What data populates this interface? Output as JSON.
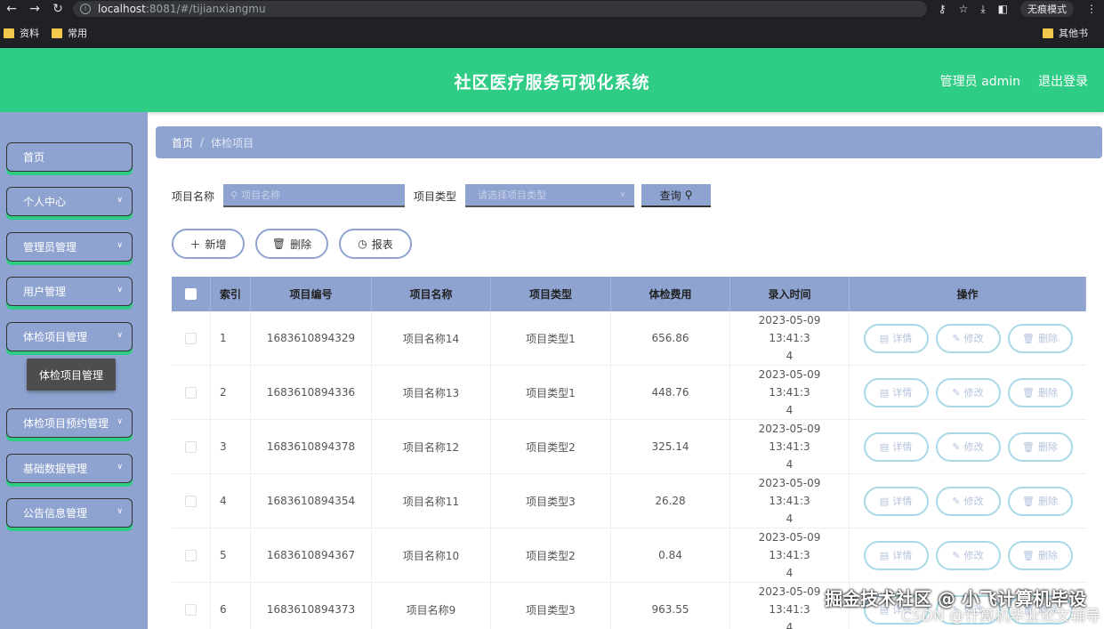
{
  "browser": {
    "url_host": "localhost",
    "url_path": ":8081/#/tijianxiangmu",
    "incognito_label": "无痕模式",
    "bookmarks": [
      "资料",
      "常用"
    ],
    "bookmarks_right": "其他书"
  },
  "header": {
    "title": "社区医疗服务可视化系统",
    "user": "管理员 admin",
    "logout": "退出登录"
  },
  "sidebar": {
    "items": [
      {
        "label": "首页"
      },
      {
        "label": "个人中心"
      },
      {
        "label": "管理员管理"
      },
      {
        "label": "用户管理"
      },
      {
        "label": "体检项目管理"
      },
      {
        "label": "体检项目预约管理"
      },
      {
        "label": "基础数据管理"
      },
      {
        "label": "公告信息管理"
      }
    ],
    "submenu_active": "体检项目管理"
  },
  "breadcrumb": {
    "home": "首页",
    "separator": "/",
    "current": "体检项目"
  },
  "search": {
    "name_label": "项目名称",
    "name_placeholder": "项目名称",
    "type_label": "项目类型",
    "type_placeholder": "请选择项目类型",
    "query_label": "查询"
  },
  "actions": {
    "add": "新增",
    "delete": "删除",
    "report": "报表"
  },
  "table": {
    "headers": [
      "索引",
      "项目编号",
      "项目名称",
      "项目类型",
      "体检费用",
      "录入时间",
      "操作"
    ],
    "op_labels": {
      "detail": "详情",
      "edit": "修改",
      "delete": "删除"
    },
    "rows": [
      {
        "idx": "1",
        "code": "1683610894329",
        "name": "项目名称14",
        "type": "项目类型1",
        "fee": "656.86",
        "time_a": "2023-05-09 13:41:3",
        "time_b": "4"
      },
      {
        "idx": "2",
        "code": "1683610894336",
        "name": "项目名称13",
        "type": "项目类型1",
        "fee": "448.76",
        "time_a": "2023-05-09 13:41:3",
        "time_b": "4"
      },
      {
        "idx": "3",
        "code": "1683610894378",
        "name": "项目名称12",
        "type": "项目类型2",
        "fee": "325.14",
        "time_a": "2023-05-09 13:41:3",
        "time_b": "4"
      },
      {
        "idx": "4",
        "code": "1683610894354",
        "name": "项目名称11",
        "type": "项目类型3",
        "fee": "26.28",
        "time_a": "2023-05-09 13:41:3",
        "time_b": "4"
      },
      {
        "idx": "5",
        "code": "1683610894367",
        "name": "项目名称10",
        "type": "项目类型2",
        "fee": "0.84",
        "time_a": "2023-05-09 13:41:3",
        "time_b": "4"
      },
      {
        "idx": "6",
        "code": "1683610894373",
        "name": "项目名称9",
        "type": "项目类型3",
        "fee": "963.55",
        "time_a": "2023-05-09 13:41:3",
        "time_b": "4"
      }
    ]
  },
  "watermark": {
    "line1": "掘金技术社区 @ 小飞计算机毕设",
    "line2": "CSDN @计算机毕业论文辅导"
  }
}
